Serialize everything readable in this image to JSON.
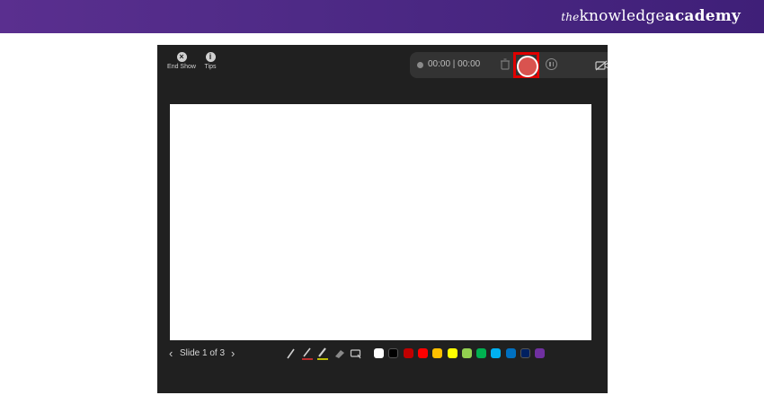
{
  "banner": {
    "brand_the": "the",
    "brand_knowledge": "knowledge",
    "brand_academy": "academy"
  },
  "top_controls": {
    "end_show": "End Show",
    "tips": "Tips"
  },
  "recording": {
    "timer": "00:00 | 00:00"
  },
  "slide_nav": {
    "label": "Slide 1 of 3",
    "prev_icon": "chevron-left-icon",
    "next_icon": "chevron-right-icon"
  },
  "pen_tools": [
    "pen",
    "red-pen",
    "highlighter",
    "eraser",
    "lasso"
  ],
  "colors": {
    "record": "#d9534f",
    "highlight_box": "#e00000",
    "swatches": [
      "#ffffff",
      "#000000",
      "#c00000",
      "#ff0000",
      "#ffc000",
      "#ffff00",
      "#92d050",
      "#00b050",
      "#00b0f0",
      "#0070c0",
      "#002060",
      "#7030a0"
    ]
  }
}
